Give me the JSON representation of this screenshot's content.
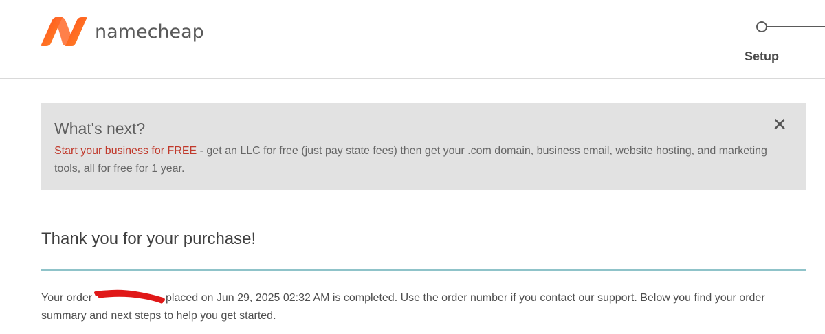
{
  "header": {
    "logo_text": "namecheap",
    "brand_color": "#ff5a1f",
    "step_label": "Setup"
  },
  "notice": {
    "title": "What's next?",
    "link_text": "Start your business for FREE",
    "body_text": " - get an LLC for free (just pay state fees) then get your .com domain, business email, website hosting, and marketing tools, all for free for 1 year.",
    "close_icon": "close-icon",
    "close_glyph": "✕",
    "link_color": "#c0392b",
    "background": "#e2e2e2"
  },
  "main": {
    "title": "Thank you for your purchase!",
    "order_prefix": "Your order",
    "order_suffix": " placed on Jun 29, 2025 02:32 AM is completed. Use the order number if you contact our support. Below you find your order summary and next steps to help you get started.",
    "divider_color": "#8fc3c9"
  }
}
